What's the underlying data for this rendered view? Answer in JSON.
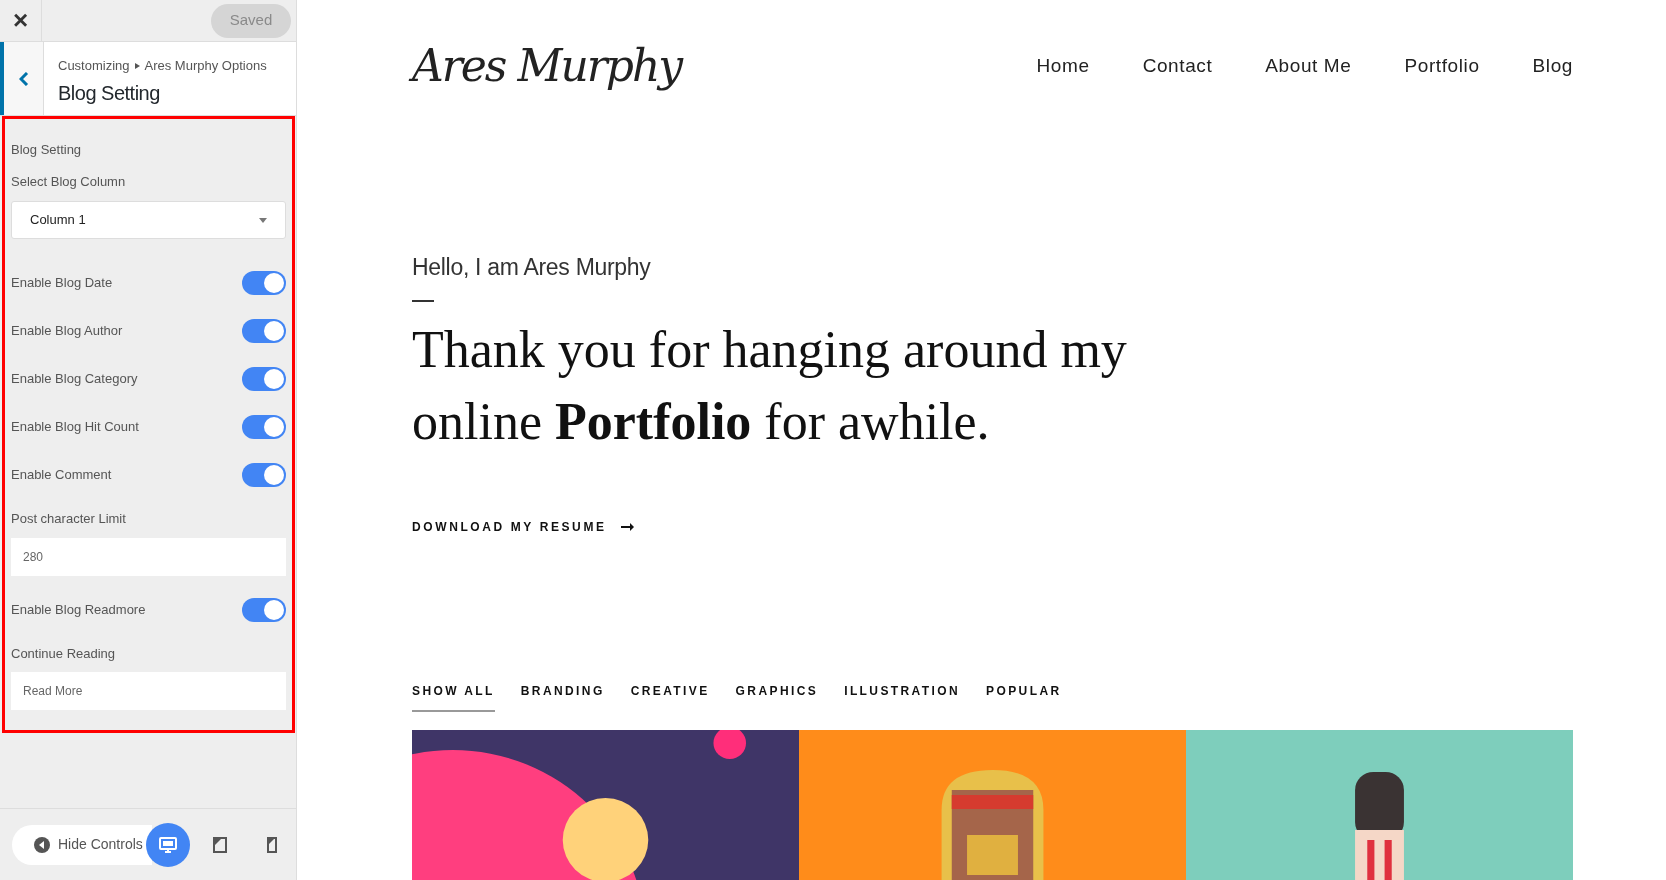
{
  "customizer": {
    "close": "×",
    "save_button": {
      "label": "Saved",
      "disabled": true
    },
    "breadcrumb": {
      "parent": "Customizing",
      "child": "Ares Murphy Options"
    },
    "title": "Blog Setting",
    "section_title": "Blog Setting",
    "controls": [
      {
        "kind": "select",
        "label": "Select Blog Column",
        "value": "Column 1"
      },
      {
        "kind": "toggle",
        "label": "Enable Blog Date",
        "on": true
      },
      {
        "kind": "toggle",
        "label": "Enable Blog Author",
        "on": true
      },
      {
        "kind": "toggle",
        "label": "Enable Blog Category",
        "on": true
      },
      {
        "kind": "toggle",
        "label": "Enable Blog Hit Count",
        "on": true
      },
      {
        "kind": "toggle",
        "label": "Enable Comment",
        "on": true
      },
      {
        "kind": "text",
        "label": "Post character Limit",
        "value": "280"
      },
      {
        "kind": "toggle",
        "label": "Enable Blog Readmore",
        "on": true
      },
      {
        "kind": "text",
        "label": "Continue Reading",
        "value": "Read More"
      }
    ],
    "footer": {
      "hide_label": "Hide Controls",
      "devices": [
        {
          "kind": "desktop",
          "selected": true
        },
        {
          "kind": "tablet",
          "selected": false
        },
        {
          "kind": "mobile",
          "selected": false
        }
      ]
    }
  },
  "site": {
    "logo": "Ares Murphy",
    "nav": [
      "Home",
      "Contact",
      "About Me",
      "Portfolio",
      "Blog"
    ],
    "greeting": "Hello, I am Ares Murphy",
    "headline": "Thank you for hanging around my online **Portfolio** for awhile.",
    "cta": "DOWNLOAD MY RESUME",
    "filters": [
      {
        "label": "SHOW ALL",
        "selected": true
      },
      {
        "label": "BRANDING",
        "selected": false
      },
      {
        "label": "CREATIVE",
        "selected": false
      },
      {
        "label": "GRAPHICS",
        "selected": false
      },
      {
        "label": "ILLUSTRATION",
        "selected": false
      },
      {
        "label": "POPULAR",
        "selected": false
      }
    ],
    "artworks": [
      {
        "kind": "planet"
      },
      {
        "kind": "portrait"
      },
      {
        "kind": "popsicle"
      }
    ]
  }
}
